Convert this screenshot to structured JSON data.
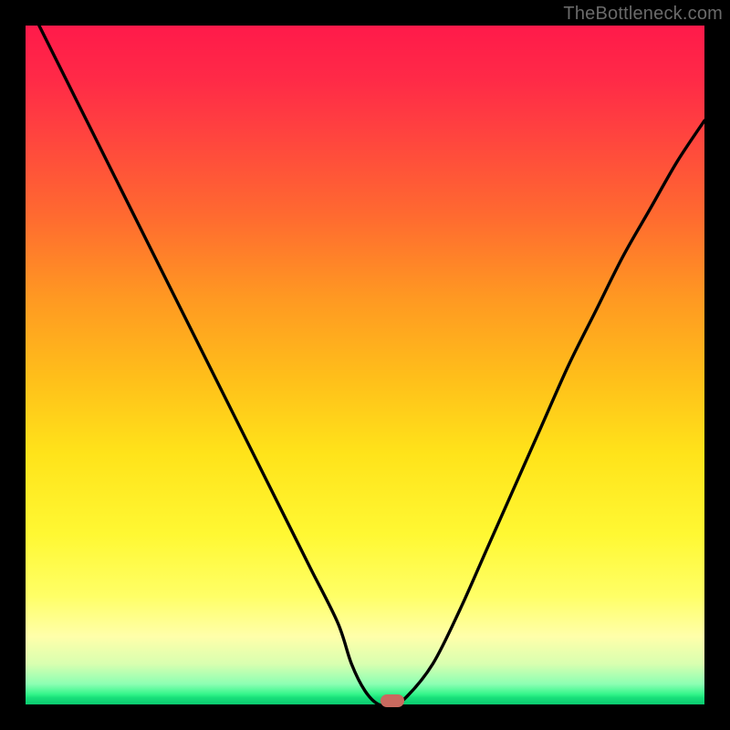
{
  "watermark_text": "TheBottleneck.com",
  "chart_data": {
    "type": "line",
    "title": "",
    "xlabel": "",
    "ylabel": "",
    "xlim": [
      0,
      100
    ],
    "ylim": [
      0,
      100
    ],
    "grid": false,
    "background": "gradient-red-yellow-green",
    "series": [
      {
        "name": "bottleneck-curve",
        "x": [
          2,
          6,
          10,
          14,
          18,
          22,
          26,
          30,
          34,
          38,
          42,
          46,
          48,
          50,
          52,
          54,
          56,
          60,
          64,
          68,
          72,
          76,
          80,
          84,
          88,
          92,
          96,
          100
        ],
        "values": [
          100,
          92,
          84,
          76,
          68,
          60,
          52,
          44,
          36,
          28,
          20,
          12,
          6,
          2,
          0,
          0,
          1,
          6,
          14,
          23,
          32,
          41,
          50,
          58,
          66,
          73,
          80,
          86
        ]
      }
    ],
    "marker": {
      "x": 54,
      "y": 0.5,
      "color": "#c96a5f"
    }
  }
}
